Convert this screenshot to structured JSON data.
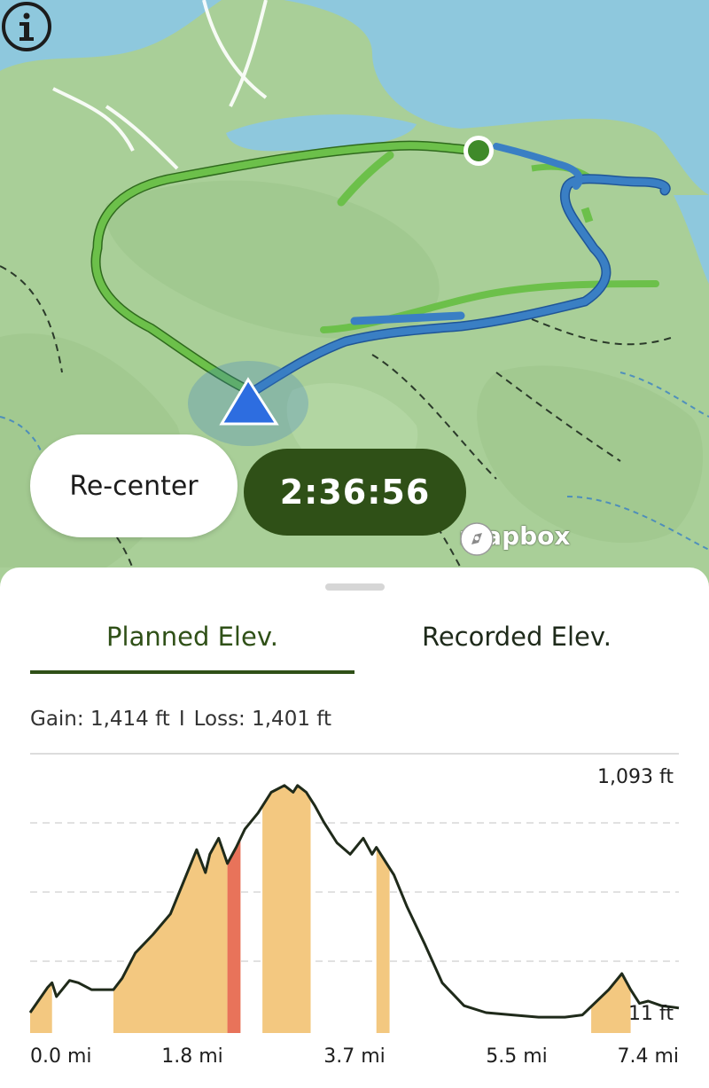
{
  "map": {
    "recenter_label": "Re-center",
    "timer": "2:36:56",
    "attribution": "mapbox",
    "info_icon": "info-icon",
    "colors": {
      "water": "#8ec8dd",
      "land": "#a9cf98",
      "planned_route": "#6cc04a",
      "recorded_route": "#3a7fc4",
      "timer_bg": "#2f5017"
    }
  },
  "sheet": {
    "tabs": [
      {
        "label": "Planned Elev.",
        "active": true
      },
      {
        "label": "Recorded Elev.",
        "active": false
      }
    ],
    "stats": {
      "gain": "Gain: 1,414 ft",
      "loss": "Loss: 1,401 ft"
    }
  },
  "chart_data": {
    "type": "area",
    "ymax_label": "1,093 ft",
    "ymin_label": "11 ft",
    "x_tick_labels": [
      "0.0 mi",
      "1.8 mi",
      "3.7 mi",
      "5.5 mi",
      "7.4 mi"
    ],
    "ylim": [
      11,
      1093
    ],
    "xlim": [
      0,
      7.4
    ],
    "grid": true,
    "series": [
      {
        "x": [
          0,
          0.2,
          0.25,
          0.3,
          0.45,
          0.55,
          0.7,
          0.95,
          1.05,
          1.2,
          1.4,
          1.6,
          1.75,
          1.9,
          2.0,
          2.05,
          2.15,
          2.25,
          2.35,
          2.45,
          2.6,
          2.75,
          2.9,
          3.0,
          3.05,
          3.15,
          3.25,
          3.35,
          3.5,
          3.65,
          3.8,
          3.9,
          3.95,
          4.05,
          4.15,
          4.3,
          4.5,
          4.7,
          4.95,
          5.2,
          5.5,
          5.8,
          6.1,
          6.3,
          6.6,
          6.75,
          6.85,
          6.95,
          7.05,
          7.2,
          7.4
        ],
        "y": [
          100,
          210,
          230,
          170,
          240,
          230,
          200,
          200,
          250,
          360,
          440,
          530,
          670,
          810,
          710,
          790,
          860,
          750,
          820,
          900,
          970,
          1060,
          1090,
          1060,
          1090,
          1060,
          1000,
          930,
          840,
          790,
          860,
          790,
          820,
          760,
          700,
          560,
          400,
          230,
          130,
          100,
          90,
          80,
          80,
          90,
          200,
          270,
          200,
          140,
          150,
          130,
          120
        ]
      }
    ],
    "highlight_bands": [
      {
        "from": 0,
        "to": 0.25,
        "color": "#f3c880"
      },
      {
        "from": 0.95,
        "to": 2.25,
        "color": "#f3c880"
      },
      {
        "from": 2.25,
        "to": 2.4,
        "color": "#e8735a"
      },
      {
        "from": 2.65,
        "to": 3.2,
        "color": "#f3c880"
      },
      {
        "from": 3.95,
        "to": 4.1,
        "color": "#f3c880"
      },
      {
        "from": 6.4,
        "to": 6.85,
        "color": "#f3c880"
      }
    ]
  }
}
